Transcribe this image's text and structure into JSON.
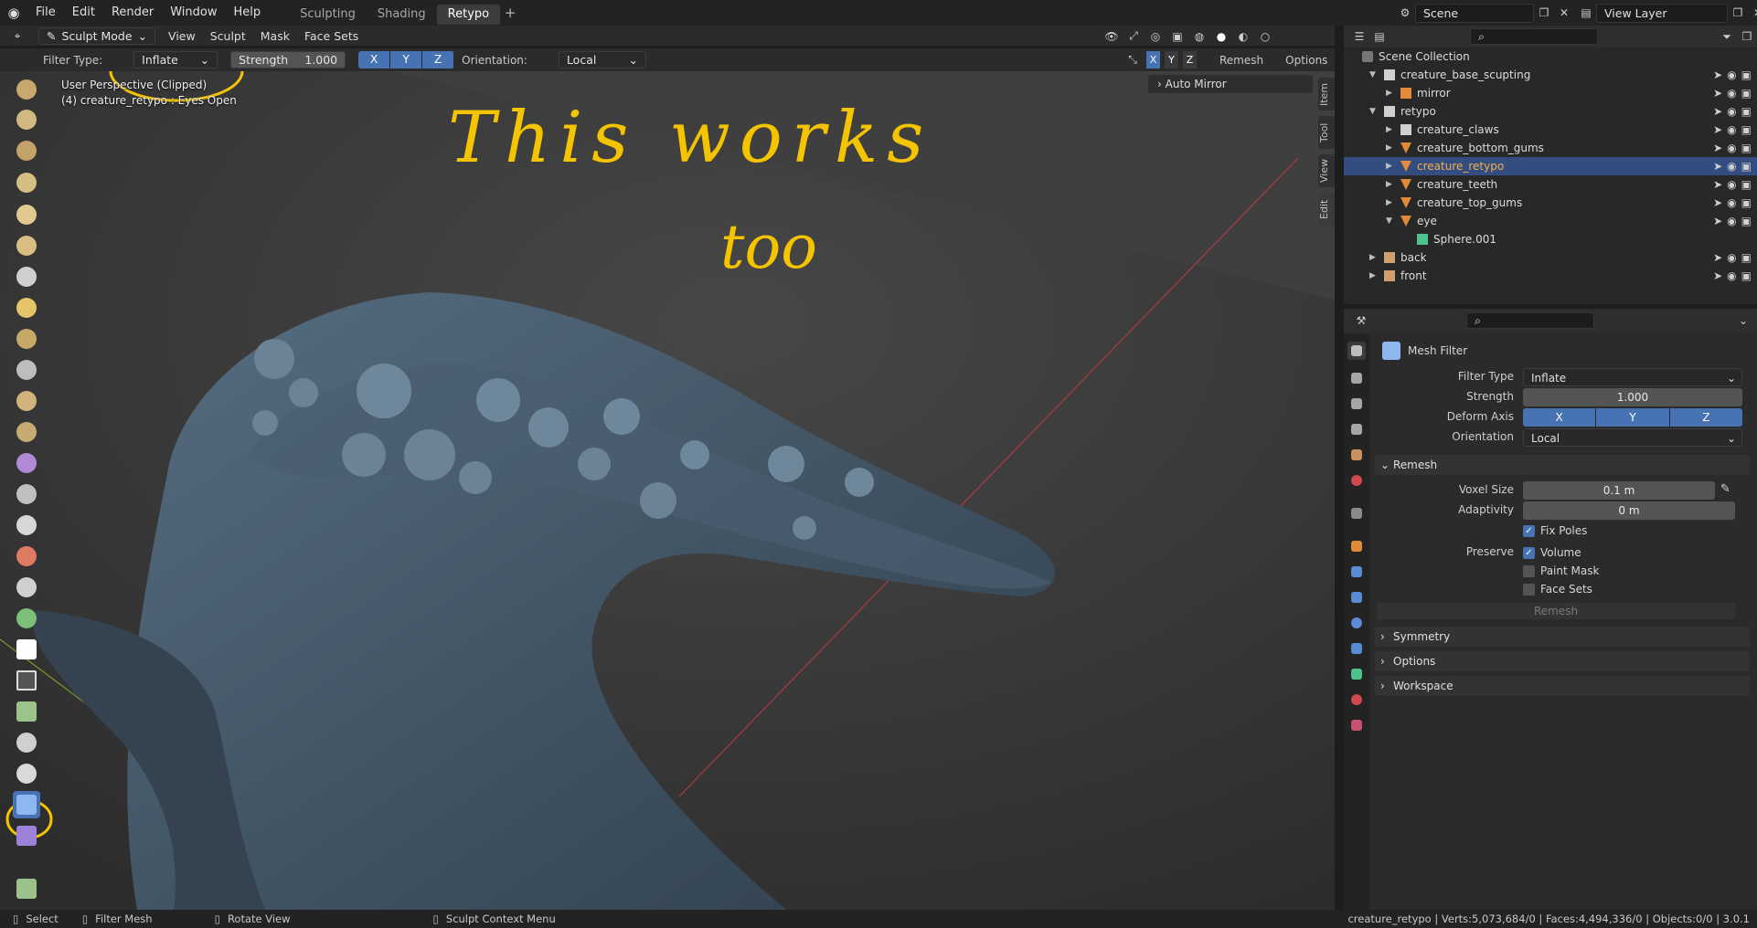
{
  "topbar": {
    "menus": [
      "File",
      "Edit",
      "Render",
      "Window",
      "Help"
    ],
    "workspaces": [
      {
        "label": "Sculpting",
        "active": false
      },
      {
        "label": "Shading",
        "active": false
      },
      {
        "label": "Retypo",
        "active": true
      }
    ],
    "add_tab": "+",
    "scene": "Scene",
    "view_layer": "View Layer"
  },
  "viewport_header": {
    "mode": "Sculpt Mode",
    "menus": [
      "View",
      "Sculpt",
      "Mask",
      "Face Sets"
    ]
  },
  "tool_settings": {
    "filter_type_label": "Filter Type:",
    "filter_type_value": "Inflate",
    "strength_label": "Strength",
    "strength_value": "1.000",
    "axes": [
      "X",
      "Y",
      "Z"
    ],
    "orientation_label": "Orientation:",
    "orientation_value": "Local",
    "sym_axes": [
      "X",
      "Y",
      "Z"
    ],
    "remesh": "Remesh",
    "options": "Options"
  },
  "viewport": {
    "perspective": "User Perspective (Clipped)",
    "object_info": "(4) creature_retypo : Eyes Open",
    "annotation_line1": "This works",
    "annotation_line2": "too",
    "side_tabs": [
      "Item",
      "Tool",
      "View",
      "Edit"
    ],
    "auto_mirror": "Auto Mirror",
    "accent_color": "#f5c400"
  },
  "outliner": {
    "search_placeholder": "",
    "root": "Scene Collection",
    "rows": [
      {
        "name": "creature_base_scupting",
        "depth": 1,
        "type": "collection",
        "expanded": true
      },
      {
        "name": "mirror",
        "depth": 2,
        "type": "empty",
        "expanded": false
      },
      {
        "name": "retypo",
        "depth": 1,
        "type": "collection",
        "expanded": true
      },
      {
        "name": "creature_claws",
        "depth": 2,
        "type": "collection",
        "expanded": false
      },
      {
        "name": "creature_bottom_gums",
        "depth": 2,
        "type": "mesh",
        "expanded": false
      },
      {
        "name": "creature_retypo",
        "depth": 2,
        "type": "mesh",
        "expanded": false,
        "selected": true
      },
      {
        "name": "creature_teeth",
        "depth": 2,
        "type": "mesh",
        "expanded": false
      },
      {
        "name": "creature_top_gums",
        "depth": 2,
        "type": "mesh",
        "expanded": false
      },
      {
        "name": "eye",
        "depth": 2,
        "type": "mesh",
        "expanded": true
      },
      {
        "name": "Sphere.001",
        "depth": 3,
        "type": "meshdata",
        "expanded": false
      },
      {
        "name": "back",
        "depth": 1,
        "type": "image",
        "expanded": false
      },
      {
        "name": "front",
        "depth": 1,
        "type": "image",
        "expanded": false
      }
    ]
  },
  "properties": {
    "panel_title": "Mesh Filter",
    "filter_type_label": "Filter Type",
    "filter_type_value": "Inflate",
    "strength_label": "Strength",
    "strength_value": "1.000",
    "deform_axis_label": "Deform Axis",
    "deform_axes": [
      "X",
      "Y",
      "Z"
    ],
    "orientation_label": "Orientation",
    "orientation_value": "Local",
    "remesh_panel": "Remesh",
    "voxel_size_label": "Voxel Size",
    "voxel_size_value": "0.1 m",
    "adaptivity_label": "Adaptivity",
    "adaptivity_value": "0 m",
    "fix_poles": "Fix Poles",
    "preserve_label": "Preserve",
    "volume": "Volume",
    "paint_mask": "Paint Mask",
    "face_sets": "Face Sets",
    "remesh_button": "Remesh",
    "symmetry_panel": "Symmetry",
    "options_panel": "Options",
    "workspace_panel": "Workspace"
  },
  "statusbar": {
    "select": "Select",
    "filter_mesh": "Filter Mesh",
    "rotate_view": "Rotate View",
    "context_menu": "Sculpt Context Menu",
    "stats": "creature_retypo | Verts:5,073,684/0 | Faces:4,494,336/0 | Objects:0/0 | 3.0.1"
  }
}
